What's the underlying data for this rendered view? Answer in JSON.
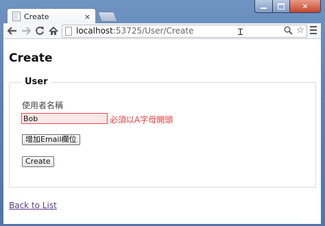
{
  "window": {
    "tab_title": "Create",
    "tab_close": "×",
    "url_host": "localhost",
    "url_rest": ":53725/User/Create"
  },
  "page": {
    "title": "Create",
    "legend": "User",
    "username_label": "使用者名稱",
    "username_value": "Bob",
    "validation_error": "必須以A字母開頭",
    "add_email_button": "增加Email欄位",
    "create_button": "Create",
    "back_link": "Back to List"
  },
  "colors": {
    "error": "#e63b3b",
    "link": "#5a3a8a"
  }
}
